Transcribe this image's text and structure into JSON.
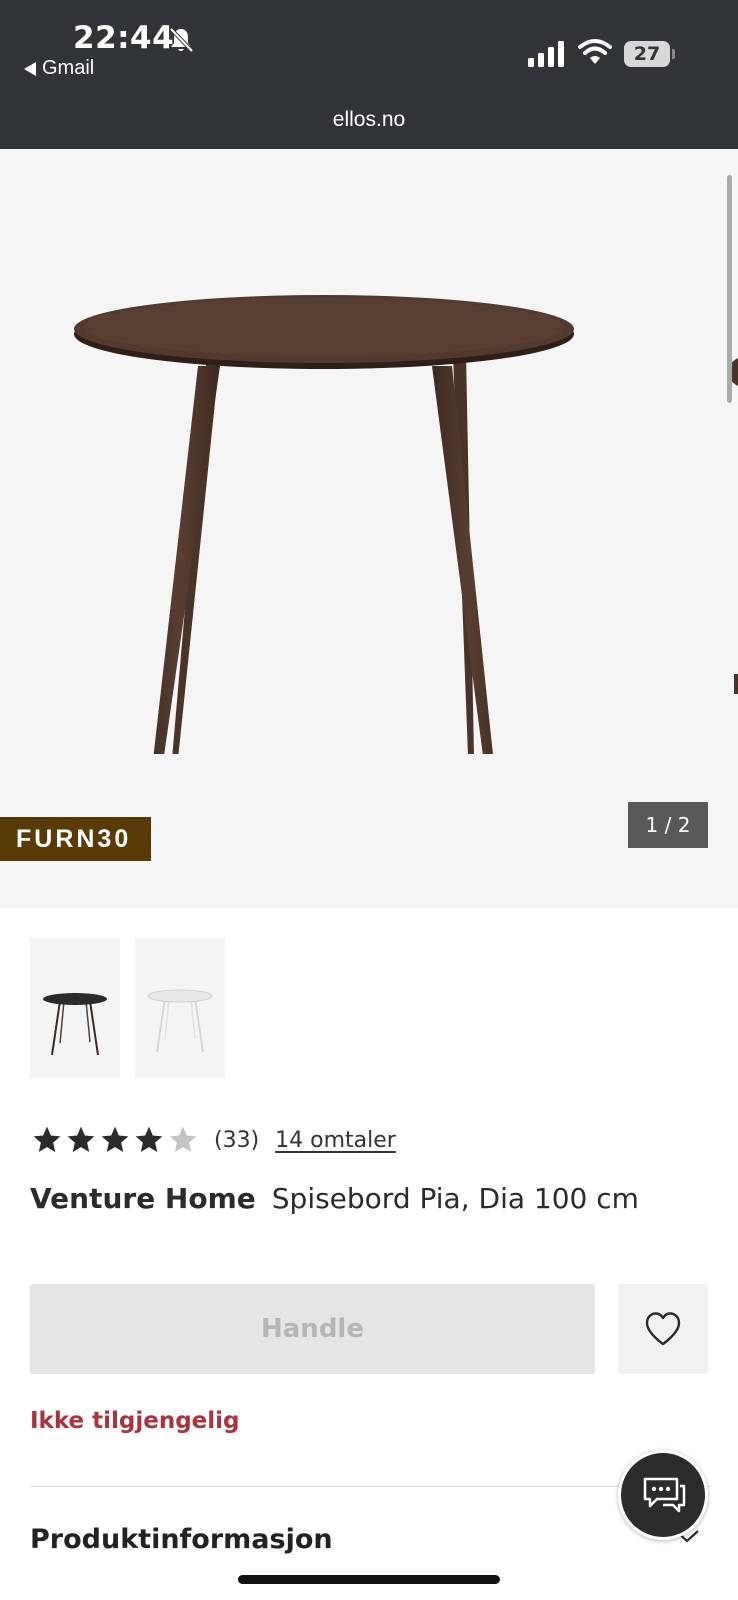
{
  "status_bar": {
    "time": "22:44",
    "back_app": "Gmail",
    "battery": "27",
    "url": "ellos.no",
    "icons": [
      "bell-slash-icon",
      "cellular-signal-icon",
      "wifi-icon",
      "battery-icon"
    ]
  },
  "gallery": {
    "promo_code": "FURN30",
    "counter": "1 / 2",
    "current_image": 1,
    "total_images": 2,
    "thumbnails": [
      "dark-table",
      "white-table"
    ]
  },
  "rating": {
    "stars": 4,
    "max_stars": 5,
    "count": "(33)",
    "reviews_link": "14 omtaler"
  },
  "product": {
    "brand": "Venture Home",
    "name": "Spisebord Pia, Dia 100 cm"
  },
  "actions": {
    "buy_label": "Handle",
    "favorite_icon": "heart-icon",
    "availability": "Ikke tilgjengelig"
  },
  "sections": {
    "product_info": "Produktinformasjon"
  },
  "colors": {
    "status_bar_bg": "#313438",
    "promo_bg": "#5a3a06",
    "unavailable_text": "#a8343f",
    "table_wood": "#4a3328"
  }
}
